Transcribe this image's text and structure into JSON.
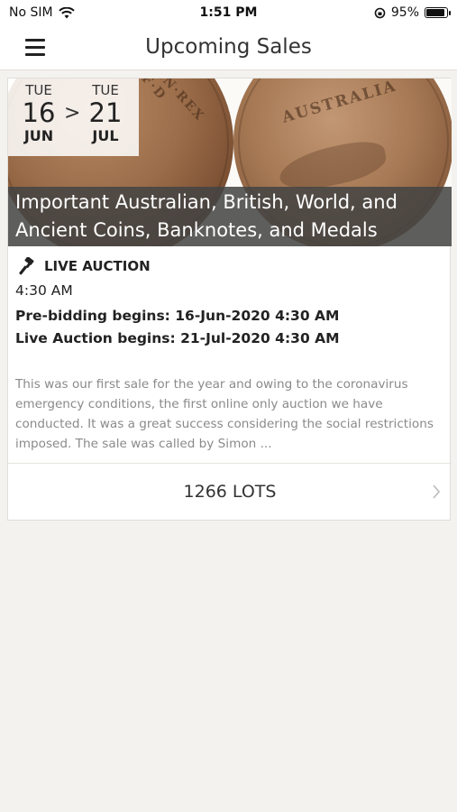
{
  "status_bar": {
    "carrier": "No SIM",
    "time": "1:51 PM",
    "battery": "95%",
    "battery_level": 0.95
  },
  "nav": {
    "title": "Upcoming Sales"
  },
  "sale": {
    "start": {
      "weekday": "TUE",
      "day": "16",
      "month": "JUN"
    },
    "separator": ">",
    "end": {
      "weekday": "TUE",
      "day": "21",
      "month": "JUL"
    },
    "title": "Important Australian, British, World, and Ancient Coins, Banknotes, and Medals",
    "auction_type": "LIVE AUCTION",
    "time": "4:30 AM",
    "pre_bidding": "Pre-bidding begins: 16-Jun-2020 4:30 AM",
    "live_begins": "Live Auction begins: 21-Jul-2020 4:30 AM",
    "description": "This was our first sale for the year and owing to the coronavirus emergency conditions, the first online only auction we have conducted. It was a great success considering the social restrictions imposed. The sale was called by Simon ...",
    "lots": "1266 LOTS",
    "coin_legend_left": "MN·REX F·D",
    "coin_legend_right": "AUSTRALIA"
  }
}
